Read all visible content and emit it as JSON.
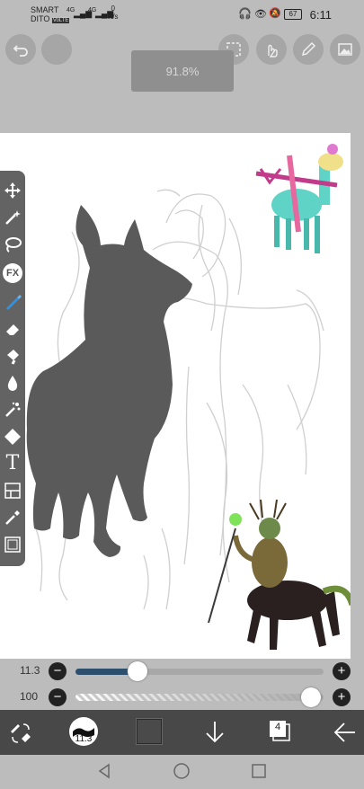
{
  "status": {
    "carrier_line1": "SMART",
    "carrier_line2": "DITO",
    "volte_badge": "VoLTE",
    "net1": "4G",
    "net2": "4G",
    "speed_value": "0",
    "speed_unit": "K/s",
    "battery": "67",
    "time": "6:11"
  },
  "zoom": {
    "value": "91.8%"
  },
  "brush": {
    "size": "11.3",
    "opacity": "100",
    "size_fraction": 0.25,
    "opacity_fraction": 0.95
  },
  "bottom": {
    "brush_preview_label": "11.3",
    "layers_count": "4"
  },
  "colors": {
    "accent": "#2d4f6e",
    "toolbar": "#636363",
    "active_tool": "#3a8fd9",
    "sketch": "#c8c8c8",
    "silhouette": "#5a5a5a"
  },
  "icons": [
    "undo-icon",
    "selection-icon",
    "gesture-icon",
    "pen-icon",
    "gallery-icon",
    "move-icon",
    "magic-wand-icon",
    "lasso-icon",
    "fx-icon",
    "brush-icon",
    "eraser-icon",
    "fill-icon",
    "blur-icon",
    "sparkle-icon",
    "shape-icon",
    "text-icon",
    "panel-icon",
    "eyedropper-icon",
    "canvas-icon"
  ]
}
